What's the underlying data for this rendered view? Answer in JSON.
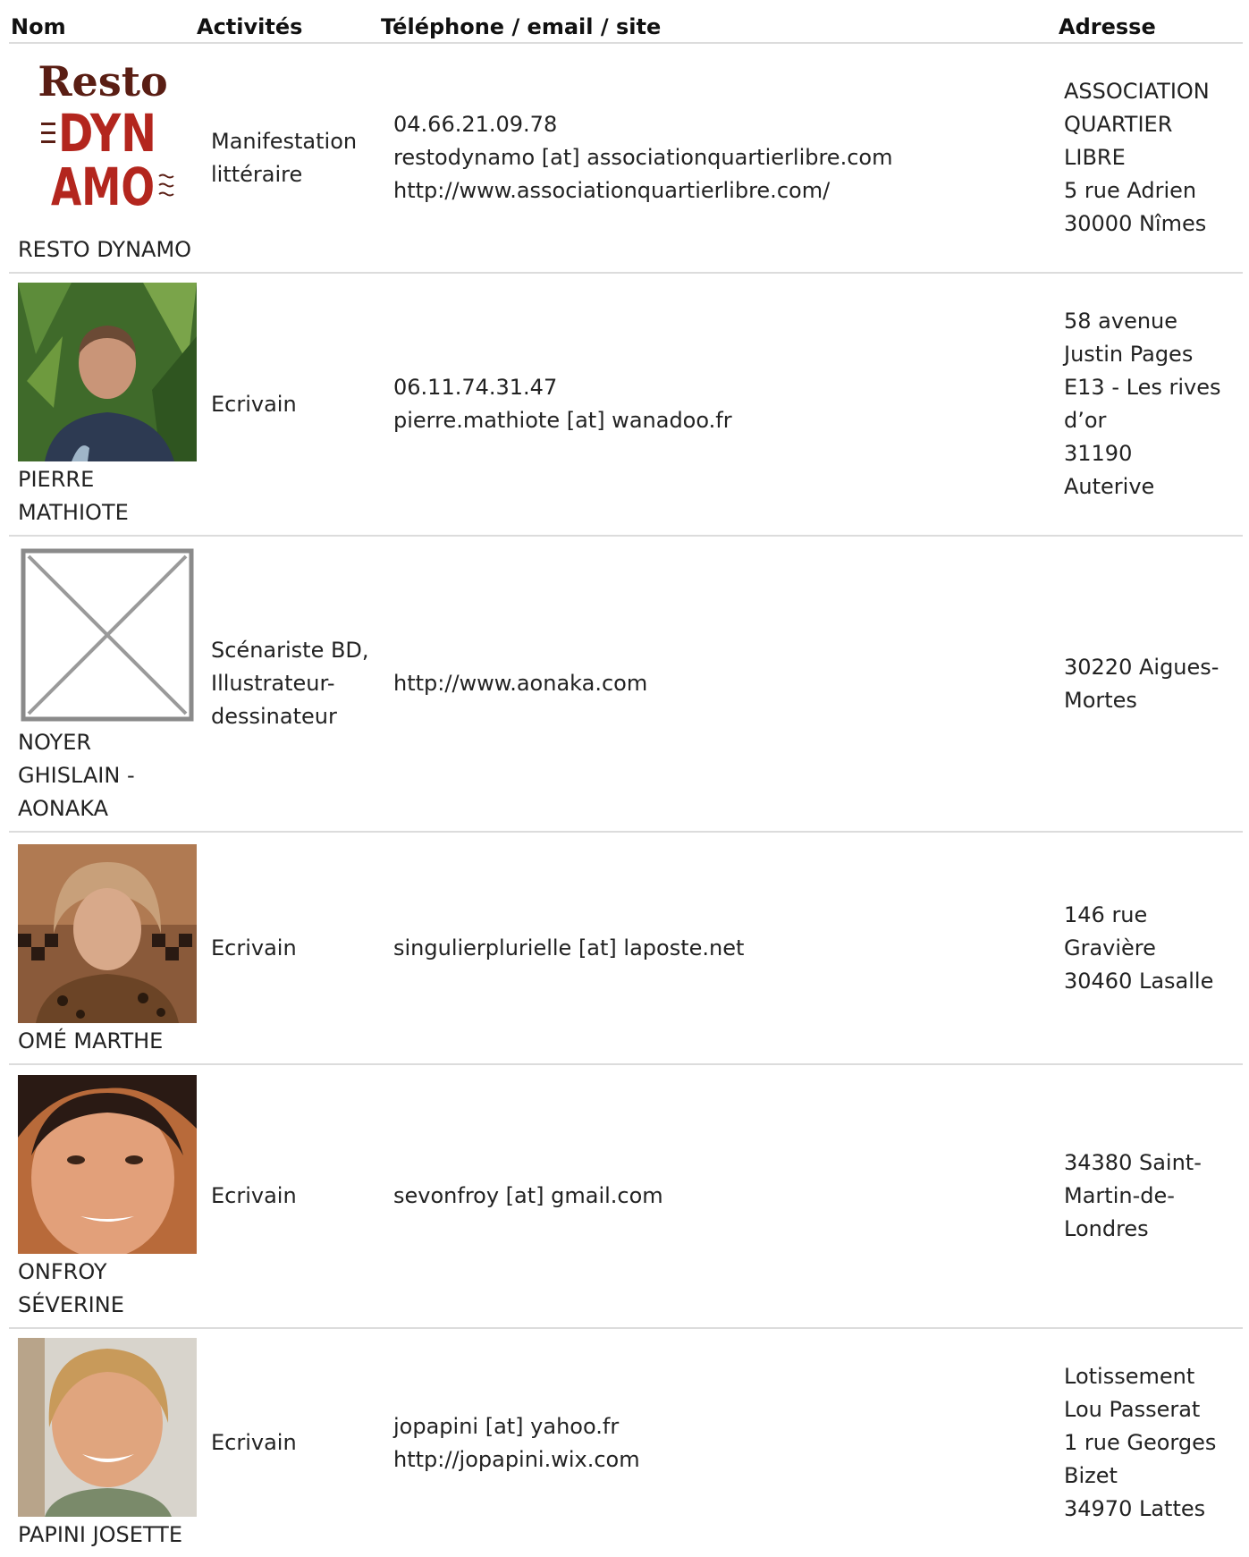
{
  "headers": {
    "nom": "Nom",
    "activites": "Activités",
    "contact": "Téléphone / email / site",
    "adresse": "Adresse"
  },
  "rows": [
    {
      "name_lines": [
        "RESTO DYNAMO"
      ],
      "logo": {
        "line1": "Resto",
        "line2": "DYN",
        "line3": "AMO"
      },
      "activity_lines": [
        "Manifestation",
        "littéraire"
      ],
      "contact_lines": [
        "04.66.21.09.78",
        "restodynamo [at] associationquartierlibre.com",
        "http://www.associationquartierlibre.com/"
      ],
      "address_lines": [
        "ASSOCIATION",
        "QUARTIER",
        "LIBRE",
        "5 rue Adrien",
        "30000 Nîmes"
      ]
    },
    {
      "name_lines": [
        "PIERRE",
        "MATHIOTE"
      ],
      "activity_lines": [
        "Ecrivain"
      ],
      "contact_lines": [
        "06.11.74.31.47",
        "pierre.mathiote [at] wanadoo.fr"
      ],
      "address_lines": [
        "58 avenue",
        "Justin Pages",
        "E13 - Les rives",
        "d’or",
        "31190",
        "Auterive"
      ]
    },
    {
      "name_lines": [
        "NOYER",
        "GHISLAIN -",
        "AONAKA"
      ],
      "activity_lines": [
        "Scénariste BD,",
        "Illustrateur-",
        "dessinateur"
      ],
      "contact_lines": [
        "http://www.aonaka.com"
      ],
      "address_lines": [
        "30220 Aigues-",
        "Mortes"
      ]
    },
    {
      "name_lines": [
        "OMÉ MARTHE"
      ],
      "activity_lines": [
        "Ecrivain"
      ],
      "contact_lines": [
        "singulierplurielle [at] laposte.net"
      ],
      "address_lines": [
        "146 rue",
        "Gravière",
        "30460 Lasalle"
      ]
    },
    {
      "name_lines": [
        "ONFROY",
        "SÉVERINE"
      ],
      "activity_lines": [
        "Ecrivain"
      ],
      "contact_lines": [
        "sevonfroy [at] gmail.com"
      ],
      "address_lines": [
        "34380 Saint-",
        "Martin-de-",
        "Londres"
      ]
    },
    {
      "name_lines": [
        "PAPINI JOSETTE"
      ],
      "activity_lines": [
        "Ecrivain"
      ],
      "contact_lines": [
        "jopapini [at] yahoo.fr",
        "http://jopapini.wix.com"
      ],
      "address_lines": [
        "Lotissement",
        "Lou Passerat",
        "1 rue Georges",
        "Bizet",
        "34970 Lattes"
      ]
    }
  ],
  "colors": {
    "logo_brown": "#5a1e14",
    "logo_red": "#b3261e",
    "divider": "#dcdcdc",
    "text": "#222222"
  }
}
